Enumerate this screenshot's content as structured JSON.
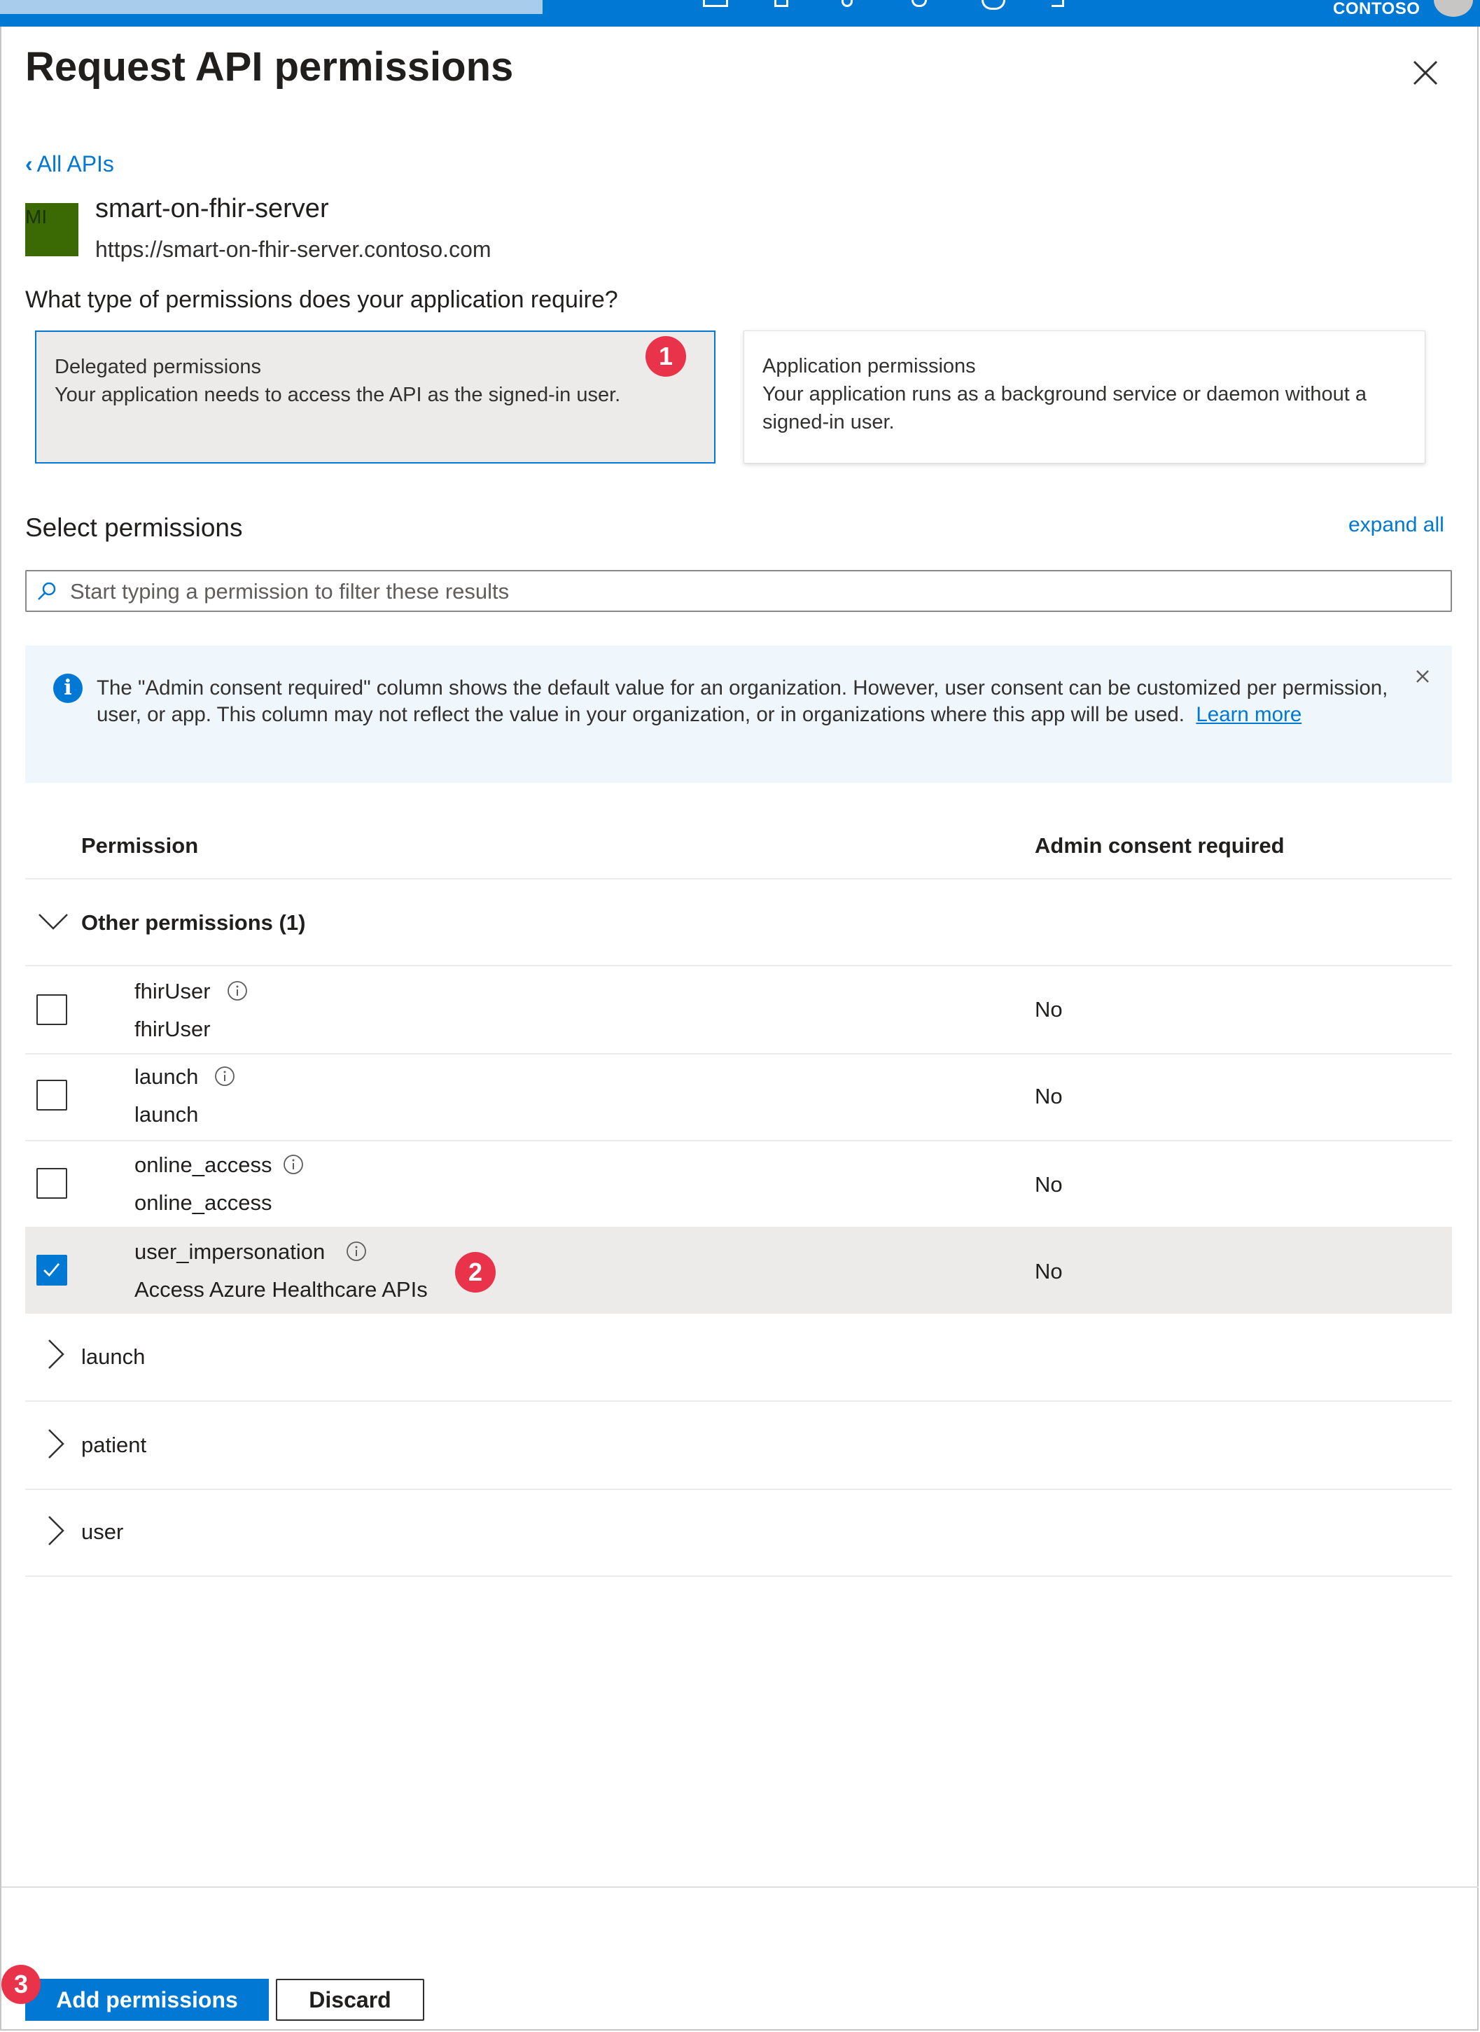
{
  "top_bar": {
    "tenant": "CONTOSO"
  },
  "panel": {
    "title": "Request API permissions",
    "back_link": "All APIs"
  },
  "api": {
    "logo_initials": "MI",
    "name": "smart-on-fhir-server",
    "url": "https://smart-on-fhir-server.contoso.com"
  },
  "question": "What type of permissions does your application require?",
  "permission_types": [
    {
      "title": "Delegated permissions",
      "description": "Your application needs to access the API as the signed-in user.",
      "selected": true
    },
    {
      "title": "Application permissions",
      "description": "Your application runs as a background service or daemon without a signed-in user.",
      "selected": false
    }
  ],
  "select_permissions": {
    "title": "Select permissions",
    "expand_all": "expand all",
    "search_placeholder": "Start typing a permission to filter these results"
  },
  "info_bar": {
    "text": "The \"Admin consent required\" column shows the default value for an organization. However, user consent can be customized per permission, user, or app. This column may not reflect the value in your organization, or in organizations where this app will be used.",
    "link": "Learn more"
  },
  "table": {
    "columns": [
      "Permission",
      "Admin consent required"
    ],
    "groups": [
      {
        "label": "Other permissions (1)",
        "expanded": true,
        "items": [
          {
            "name": "fhirUser",
            "description": "fhirUser",
            "admin_consent": "No",
            "checked": false
          },
          {
            "name": "launch",
            "description": "launch",
            "admin_consent": "No",
            "checked": false
          },
          {
            "name": "online_access",
            "description": "online_access",
            "admin_consent": "No",
            "checked": false
          },
          {
            "name": "user_impersonation",
            "description": "Access Azure Healthcare APIs",
            "admin_consent": "No",
            "checked": true
          }
        ]
      },
      {
        "label": "launch",
        "expanded": false
      },
      {
        "label": "patient",
        "expanded": false
      },
      {
        "label": "user",
        "expanded": false
      }
    ]
  },
  "callouts": [
    "1",
    "2",
    "3"
  ],
  "footer": {
    "primary_button": "Add permissions",
    "secondary_button": "Discard"
  },
  "colors": {
    "accent": "#0078d4",
    "callout": "#e8334a",
    "selected_row": "#edebe9",
    "info_background": "#eff6fc"
  }
}
